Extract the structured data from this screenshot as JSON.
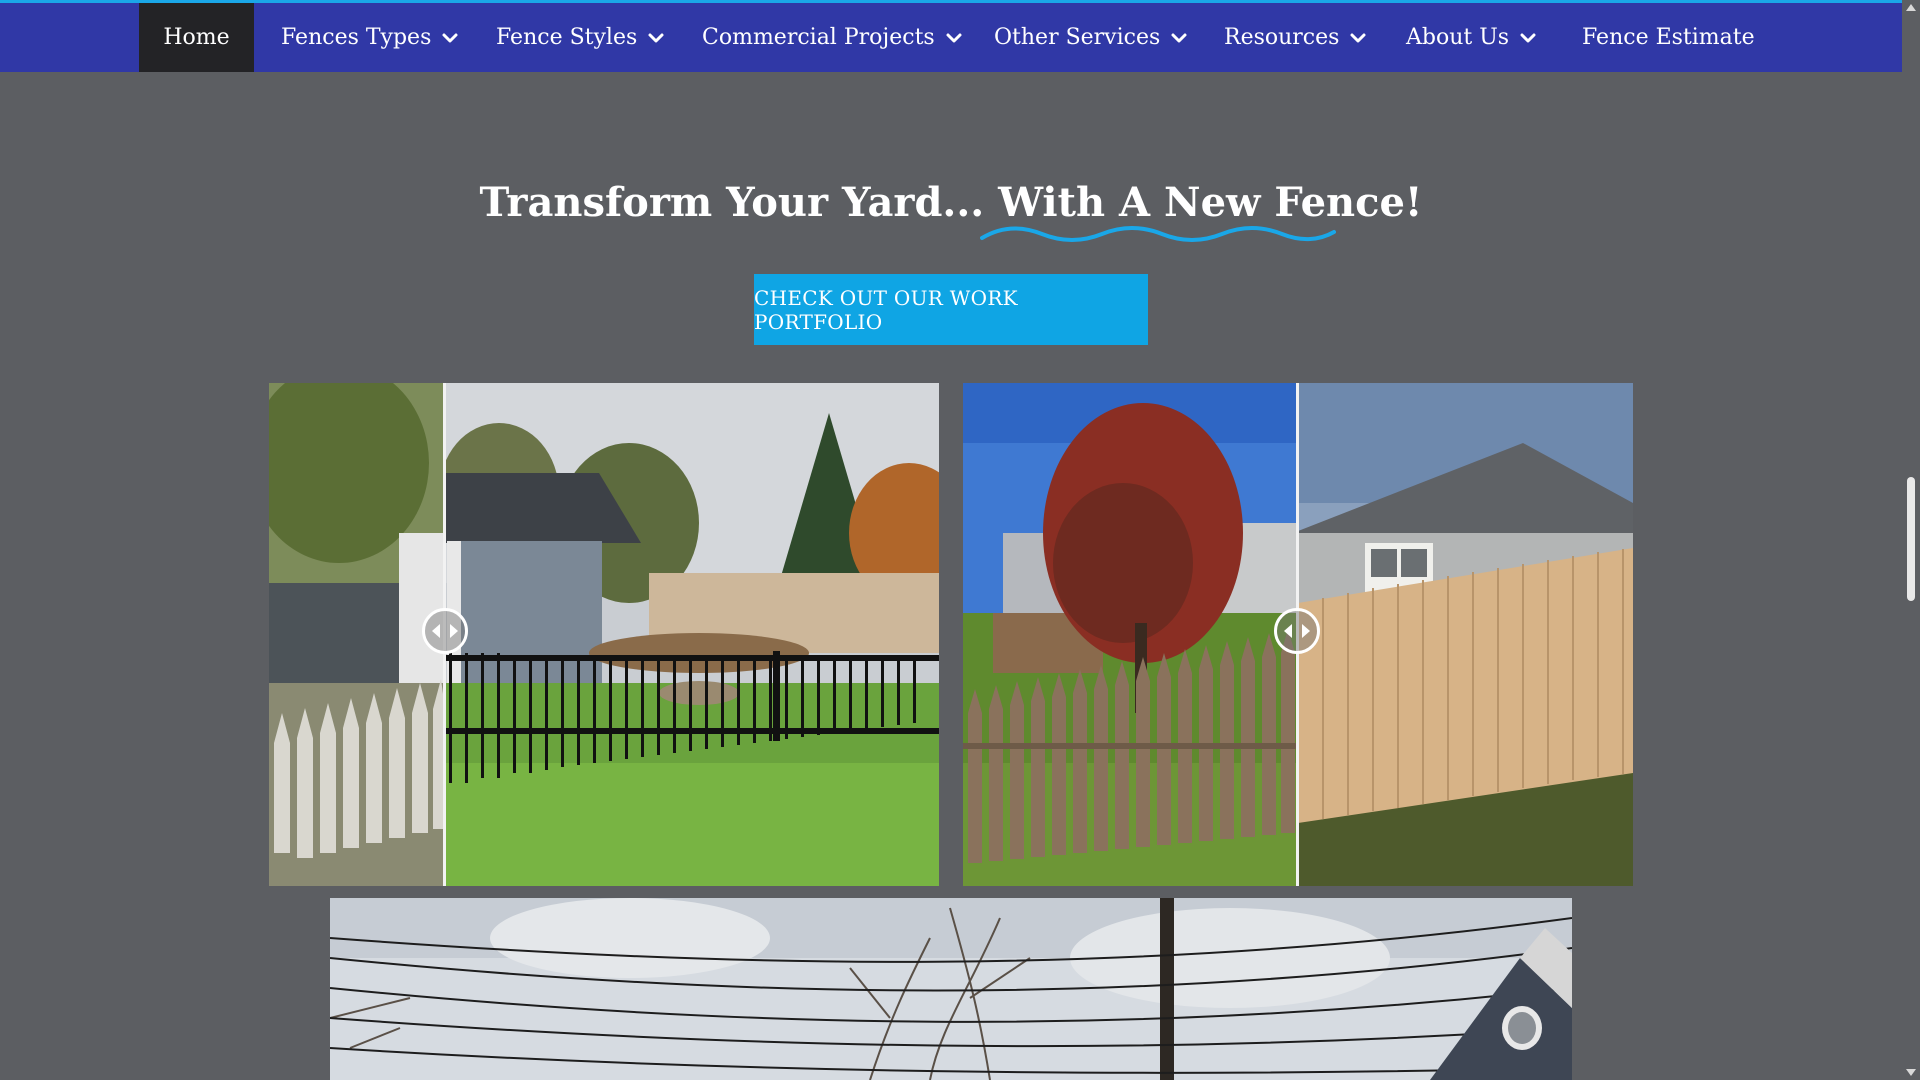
{
  "colors": {
    "nav_bg": "#3038a6",
    "nav_active_bg": "#232326",
    "accent": "#1aa7e8",
    "button_bg": "#0fa5e4",
    "page_bg": "#5c5e62"
  },
  "nav": {
    "items": [
      {
        "label": "Home",
        "dropdown": false,
        "active": true
      },
      {
        "label": "Fences Types",
        "dropdown": true
      },
      {
        "label": "Fence Styles",
        "dropdown": true
      },
      {
        "label": "Commercial Projects",
        "dropdown": true
      },
      {
        "label": "Other Services",
        "dropdown": true
      },
      {
        "label": "Resources",
        "dropdown": true
      },
      {
        "label": "About Us",
        "dropdown": true
      },
      {
        "label": "Fence Estimate",
        "dropdown": false
      }
    ]
  },
  "hero": {
    "heading_part1": "Transform Your Yard... ",
    "heading_part2": "With A New Fence!",
    "cta_label": "CHECK OUT OUR WORK PORTFOLIO"
  },
  "comparisons": [
    {
      "before": "white picket fence",
      "after": "black aluminum fence",
      "slider_position_percent": 26
    },
    {
      "before": "old wooden picket fence",
      "after": "new cedar picket fence",
      "slider_position_percent": 50
    }
  ],
  "icons": {
    "dropdown": "chevron-down-icon",
    "slider_handle": "left-right-arrows-icon"
  }
}
